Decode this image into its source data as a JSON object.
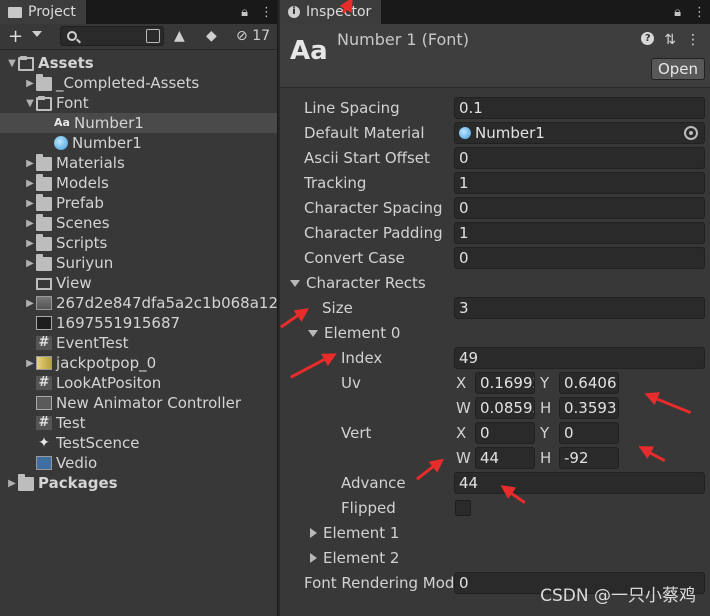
{
  "project_panel": {
    "tab_label": "Project",
    "hidden_count": "17",
    "search": {
      "placeholder": ""
    },
    "tree": [
      {
        "label": "Assets",
        "level": 0,
        "icon": "folder-open-icon",
        "expanded": true,
        "bold": true
      },
      {
        "label": "_Completed-Assets",
        "level": 1,
        "icon": "folder-icon",
        "expanded": false
      },
      {
        "label": "Font",
        "level": 1,
        "icon": "folder-open-icon",
        "expanded": true
      },
      {
        "label": "Number1",
        "level": 2,
        "icon": "font-asset-icon",
        "selected": true
      },
      {
        "label": "Number1",
        "level": 2,
        "icon": "material-sphere-icon"
      },
      {
        "label": "Materials",
        "level": 1,
        "icon": "folder-icon",
        "expanded": false
      },
      {
        "label": "Models",
        "level": 1,
        "icon": "folder-icon",
        "expanded": false
      },
      {
        "label": "Prefab",
        "level": 1,
        "icon": "folder-icon",
        "expanded": false
      },
      {
        "label": "Scenes",
        "level": 1,
        "icon": "folder-icon",
        "expanded": false
      },
      {
        "label": "Scripts",
        "level": 1,
        "icon": "folder-icon",
        "expanded": false
      },
      {
        "label": "Suriyun",
        "level": 1,
        "icon": "folder-icon",
        "expanded": false
      },
      {
        "label": "View",
        "level": 1,
        "icon": "view-folder-icon"
      },
      {
        "label": "267d2e847dfa5a2c1b068a12",
        "level": 1,
        "icon": "texture-icon",
        "expanded": false
      },
      {
        "label": "1697551915687",
        "level": 1,
        "icon": "texture-dark-icon"
      },
      {
        "label": "EventTest",
        "level": 1,
        "icon": "script-icon"
      },
      {
        "label": "jackpotpop_0",
        "level": 1,
        "icon": "texture-yellow-icon",
        "expanded": false
      },
      {
        "label": "LookAtPositon",
        "level": 1,
        "icon": "script-icon"
      },
      {
        "label": "New Animator Controller",
        "level": 1,
        "icon": "animator-icon"
      },
      {
        "label": "Test",
        "level": 1,
        "icon": "script-icon"
      },
      {
        "label": "TestScence",
        "level": 1,
        "icon": "unity-scene-icon"
      },
      {
        "label": "Vedio",
        "level": 1,
        "icon": "video-icon"
      },
      {
        "label": "Packages",
        "level": 0,
        "icon": "folder-icon",
        "expanded": false,
        "bold": true
      }
    ]
  },
  "inspector": {
    "tab_label": "Inspector",
    "asset_icon_text": "Aa",
    "asset_title": "Number 1 (Font)",
    "open_button": "Open",
    "properties": {
      "line_spacing": {
        "label": "Line Spacing",
        "value": "0.1"
      },
      "default_material": {
        "label": "Default Material",
        "value": "Number1"
      },
      "ascii_start_offset": {
        "label": "Ascii Start Offset",
        "value": "0"
      },
      "tracking": {
        "label": "Tracking",
        "value": "1"
      },
      "character_spacing": {
        "label": "Character Spacing",
        "value": "0"
      },
      "character_padding": {
        "label": "Character Padding",
        "value": "1"
      },
      "convert_case": {
        "label": "Convert Case",
        "value": "0"
      },
      "character_rects": {
        "label": "Character Rects"
      },
      "size": {
        "label": "Size",
        "value": "3"
      },
      "element0": {
        "label": "Element 0",
        "index": {
          "label": "Index",
          "value": "49"
        },
        "uv": {
          "label": "Uv",
          "x_label": "X",
          "x": "0.16992",
          "y_label": "Y",
          "y": "0.6406",
          "w_label": "W",
          "w": "0.08593",
          "h_label": "H",
          "h": "0.3593"
        },
        "vert": {
          "label": "Vert",
          "x_label": "X",
          "x": "0",
          "y_label": "Y",
          "y": "0",
          "w_label": "W",
          "w": "44",
          "h_label": "H",
          "h": "-92"
        },
        "advance": {
          "label": "Advance",
          "value": "44"
        },
        "flipped": {
          "label": "Flipped",
          "checked": false
        }
      },
      "element1": {
        "label": "Element 1"
      },
      "element2": {
        "label": "Element 2"
      },
      "font_rendering_mode": {
        "label": "Font Rendering Mode",
        "value": "0"
      }
    }
  },
  "watermark": "CSDN @一只小蔡鸡",
  "colors": {
    "panel": "#383838",
    "field": "#2a2a2a",
    "annotation": "#e82b2b"
  }
}
